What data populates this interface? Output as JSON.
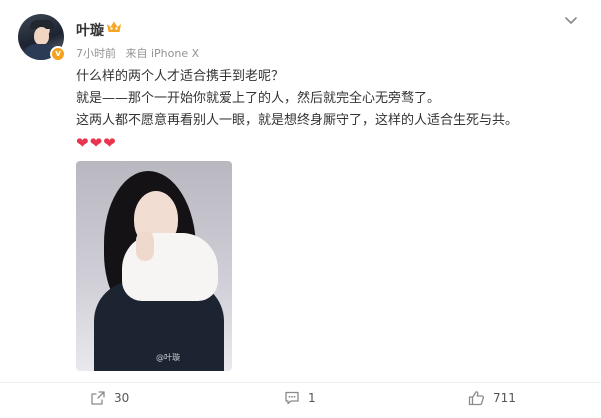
{
  "post": {
    "author": {
      "name": "叶璇"
    },
    "meta": {
      "time": "7小时前",
      "source": "来自 iPhone X"
    },
    "lines": [
      "什么样的两个人才适合携手到老呢？",
      "就是——那个一开始你就爱上了的人，然后就完全心无旁骛了。",
      "这两人都不愿意再看别人一眼，就是想终身厮守了，这样的人适合生死与共。"
    ],
    "hearts": "❤❤❤",
    "photo_watermark": "@叶璇"
  },
  "actions": {
    "repost_count": "30",
    "comment_count": "1",
    "like_count": "711"
  },
  "colors": {
    "verified_badge": "#f4a11d",
    "heart": "#e8344e",
    "meta_text": "#939393"
  },
  "icons": {
    "more": "chevron-down-icon",
    "repost": "share-icon",
    "comment": "comment-icon",
    "like": "thumbs-up-icon"
  }
}
